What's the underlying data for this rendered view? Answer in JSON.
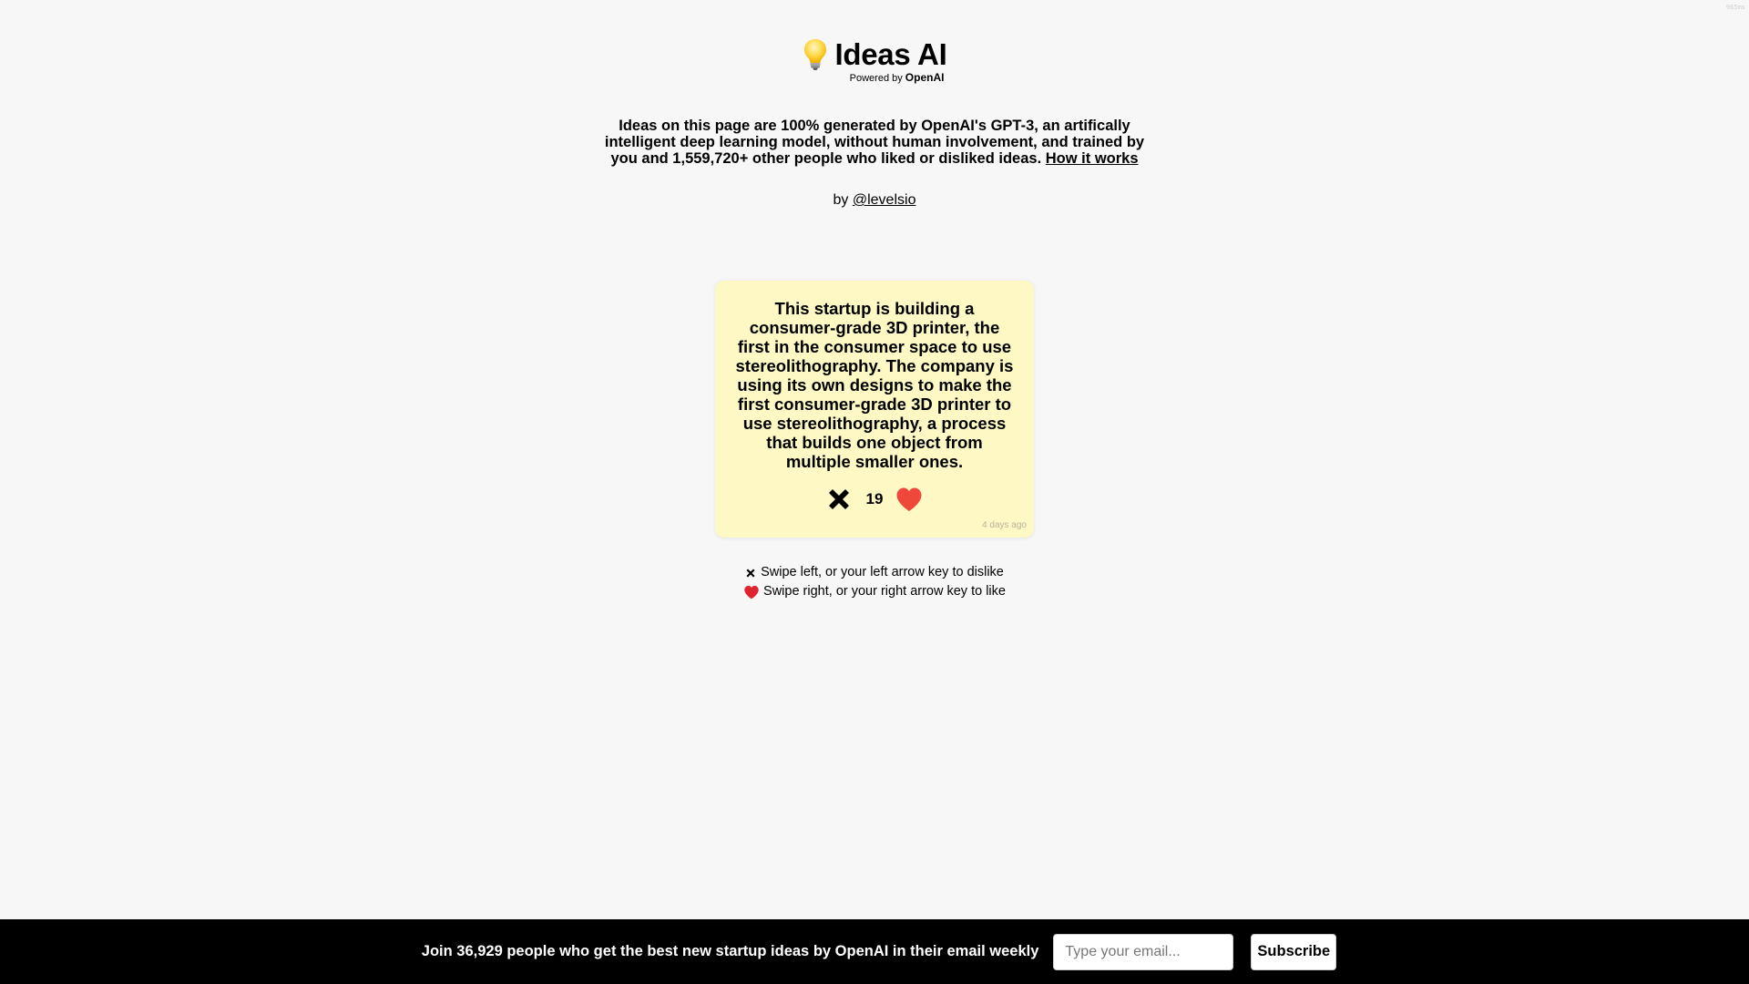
{
  "corner_tag": "965ms",
  "brand": {
    "title": "Ideas AI",
    "powered_prefix": "Powered by",
    "powered_brand": "OpenAI",
    "icon": "lightbulb-icon"
  },
  "description": {
    "text": "Ideas on this page are 100% generated by OpenAI's GPT-3, an artifically intelligent deep learning model, without human involvement, and trained by you and 1,559,720+ other people who liked or disliked ideas.",
    "link_label": "How it works"
  },
  "byline": {
    "prefix": "by",
    "author_link": "@levelsio"
  },
  "idea_card": {
    "text": "This startup is building a consumer-grade 3D printer, the first in the consumer space to use stereolithography. The company is using its own designs to make the first consumer-grade 3D printer to use stereolithography, a process that builds one object from multiple smaller ones.",
    "vote_count": "19",
    "timestamp": "4 days ago",
    "dislike_icon": "x-icon",
    "like_icon": "heart-icon",
    "card_color": "#fdf8c4",
    "heart_color": "#f0473b"
  },
  "hints": {
    "dislike": "Swipe left, or your left arrow key to dislike",
    "like": "Swipe right, or your right arrow key to like"
  },
  "footer": {
    "text": "Join 36,929 people who get the best new startup ideas by OpenAI in their email weekly",
    "email_placeholder": "Type your email...",
    "subscribe_label": "Subscribe"
  }
}
